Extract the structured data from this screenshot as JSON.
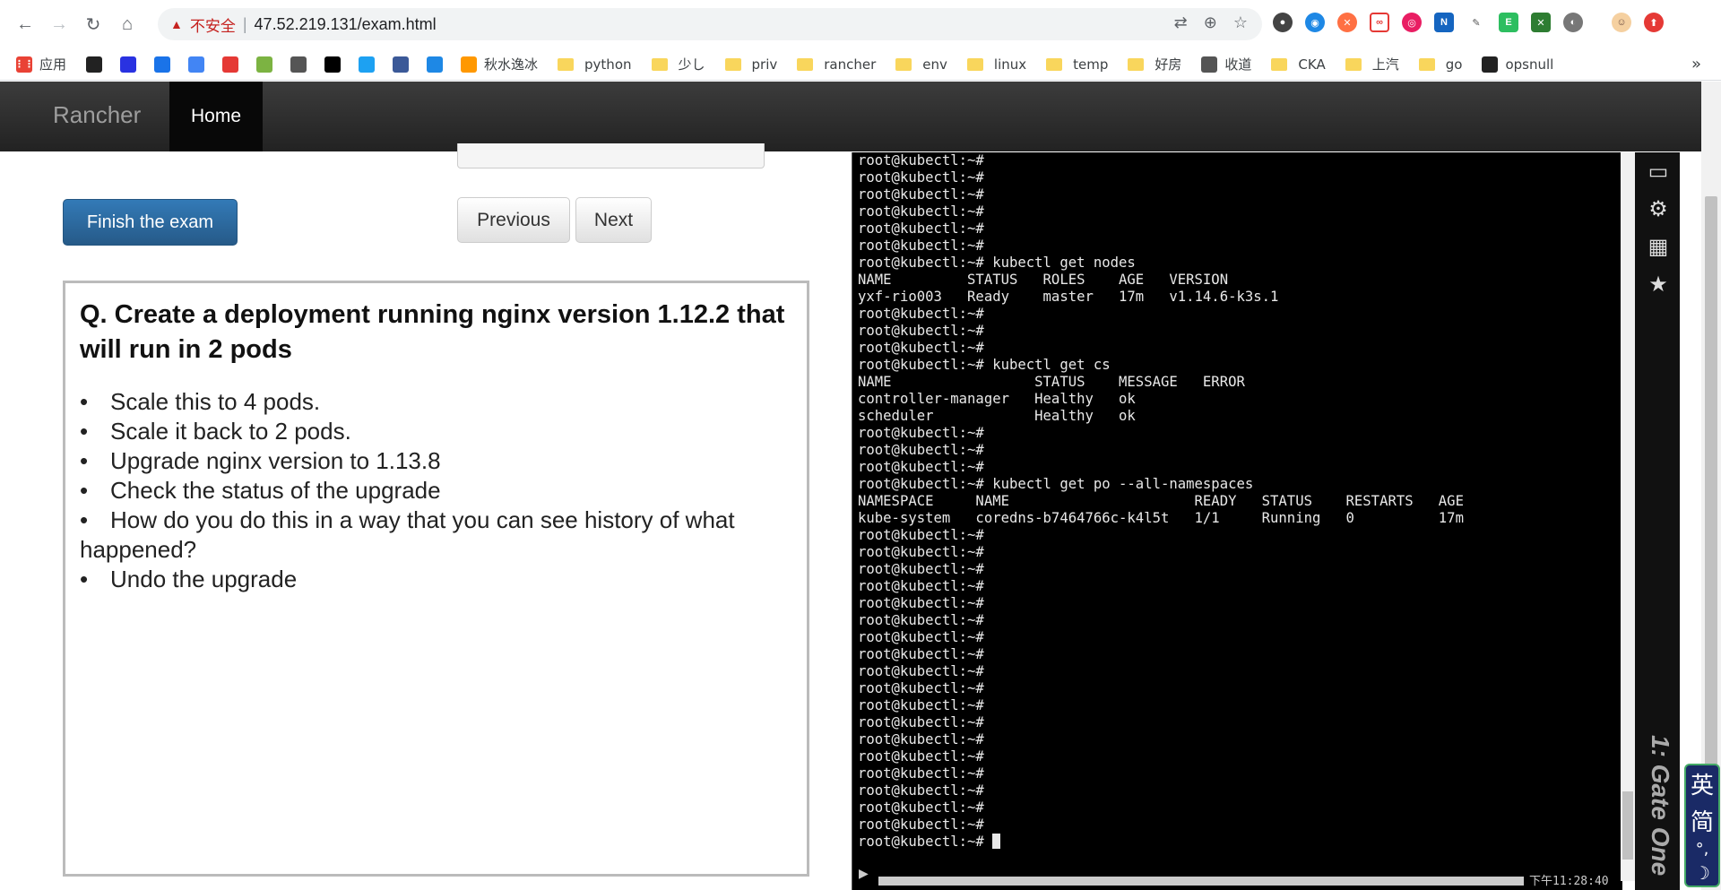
{
  "browser": {
    "insecure_label": "不安全",
    "separator": "|",
    "url": "47.52.219.131/exam.html"
  },
  "bookmarks": [
    {
      "label": "应用",
      "icon": "apps-grid-icon",
      "type": "icon",
      "color": "#e94235"
    },
    {
      "label": "",
      "icon": "github-icon",
      "type": "icon",
      "color": "#222"
    },
    {
      "label": "",
      "icon": "baidu-icon",
      "type": "icon",
      "color": "#2932e1"
    },
    {
      "label": "",
      "icon": "translate-icon",
      "type": "icon",
      "color": "#1a73e8"
    },
    {
      "label": "",
      "icon": "google-translate-icon",
      "type": "icon",
      "color": "#4285f4"
    },
    {
      "label": "",
      "icon": "c-icon",
      "type": "icon",
      "color": "#e53935"
    },
    {
      "label": "",
      "icon": "m-green-icon",
      "type": "icon",
      "color": "#7cb342"
    },
    {
      "label": "",
      "icon": "tool-icon",
      "type": "icon",
      "color": "#555"
    },
    {
      "label": "",
      "icon": "medium-icon",
      "type": "icon",
      "color": "#000"
    },
    {
      "label": "",
      "icon": "twitter-icon",
      "type": "icon",
      "color": "#1da1f2"
    },
    {
      "label": "",
      "icon": "facebook-icon",
      "type": "icon",
      "color": "#3b5998"
    },
    {
      "label": "",
      "icon": "feishu-icon",
      "type": "icon",
      "color": "#1e88e5"
    },
    {
      "label": "秋水逸冰",
      "icon": "circle-icon",
      "type": "icon",
      "color": "#ff9800"
    },
    {
      "label": "python",
      "type": "folder"
    },
    {
      "label": "少し",
      "type": "folder"
    },
    {
      "label": "priv",
      "type": "folder"
    },
    {
      "label": "rancher",
      "type": "folder"
    },
    {
      "label": "env",
      "type": "folder"
    },
    {
      "label": "linux",
      "type": "folder"
    },
    {
      "label": "temp",
      "type": "folder"
    },
    {
      "label": "好房",
      "type": "folder"
    },
    {
      "label": "收道",
      "icon": "globe-icon",
      "type": "icon",
      "color": "#555"
    },
    {
      "label": "CKA",
      "type": "folder"
    },
    {
      "label": "上汽",
      "type": "folder"
    },
    {
      "label": "go",
      "type": "folder"
    },
    {
      "label": "opsnull",
      "icon": "github-icon",
      "type": "icon",
      "color": "#222"
    }
  ],
  "bookmarks_more": "»",
  "navbar": {
    "brand": "Rancher",
    "home": "Home"
  },
  "exam": {
    "finish": "Finish the exam",
    "previous": "Previous",
    "next": "Next",
    "question_title": "Q. Create a deployment running nginx version 1.12.2 that will run in 2 pods",
    "items": [
      "Scale this to 4 pods.",
      "Scale it back to 2 pods.",
      "Upgrade nginx version to 1.13.8",
      "Check the status of the upgrade",
      "How do you do this in a way that you can see history of what happened?",
      "Undo the upgrade"
    ]
  },
  "terminal": {
    "lines": [
      "root@kubectl:~#",
      "root@kubectl:~#",
      "root@kubectl:~#",
      "root@kubectl:~#",
      "root@kubectl:~#",
      "root@kubectl:~#",
      "root@kubectl:~# kubectl get nodes",
      "NAME         STATUS   ROLES    AGE   VERSION",
      "yxf-rio003   Ready    master   17m   v1.14.6-k3s.1",
      "root@kubectl:~#",
      "root@kubectl:~#",
      "root@kubectl:~#",
      "root@kubectl:~# kubectl get cs",
      "NAME                 STATUS    MESSAGE   ERROR",
      "controller-manager   Healthy   ok",
      "scheduler            Healthy   ok",
      "root@kubectl:~#",
      "root@kubectl:~#",
      "root@kubectl:~#",
      "root@kubectl:~# kubectl get po --all-namespaces",
      "NAMESPACE     NAME                      READY   STATUS    RESTARTS   AGE",
      "kube-system   coredns-b7464766c-k4l5t   1/1     Running   0          17m",
      "root@kubectl:~#",
      "root@kubectl:~#",
      "root@kubectl:~#",
      "root@kubectl:~#",
      "root@kubectl:~#",
      "root@kubectl:~#",
      "root@kubectl:~#",
      "root@kubectl:~#",
      "root@kubectl:~#",
      "root@kubectl:~#",
      "root@kubectl:~#",
      "root@kubectl:~#",
      "root@kubectl:~#",
      "root@kubectl:~#",
      "root@kubectl:~#",
      "root@kubectl:~#",
      "root@kubectl:~#",
      "root@kubectl:~#"
    ],
    "prompt_last": "root@kubectl:~# ",
    "clock": "下午11:28:40",
    "gate_label": "1: Gate One"
  },
  "ime": {
    "lang": "英",
    "mode": "简",
    "punct": "°,",
    "moon": "☽"
  }
}
